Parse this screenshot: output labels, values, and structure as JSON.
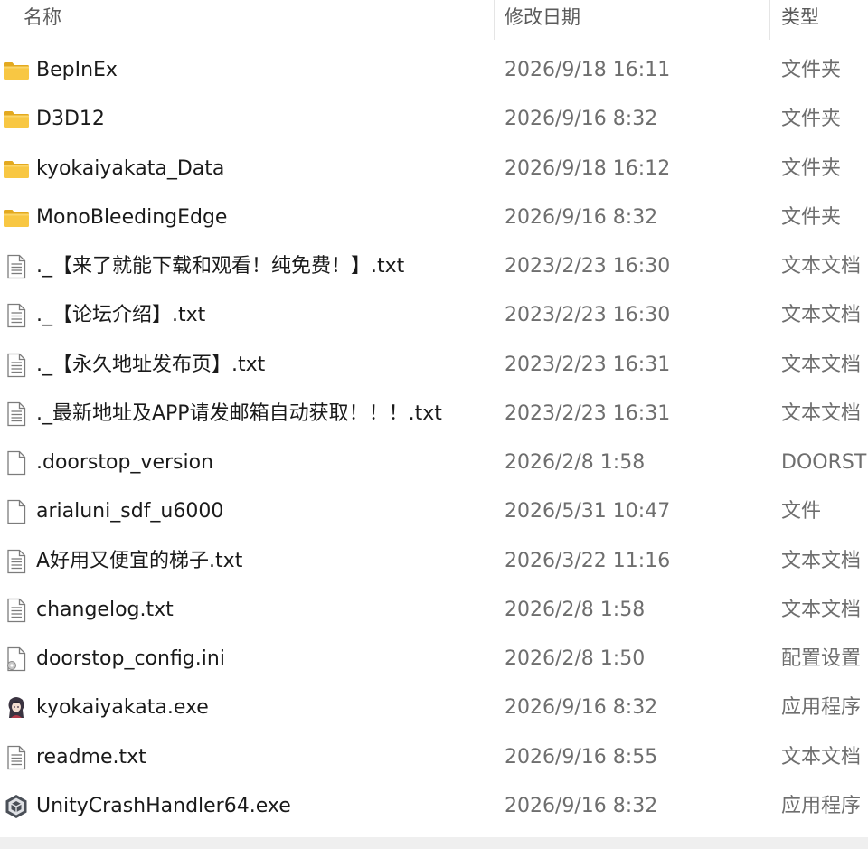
{
  "header": {
    "name_label": "名称",
    "date_label": "修改日期",
    "type_label": "类型"
  },
  "files": [
    {
      "name": "BepInEx",
      "date": "2026/9/18 16:11",
      "type": "文件夹",
      "icon": "folder-icon"
    },
    {
      "name": "D3D12",
      "date": "2026/9/16 8:32",
      "type": "文件夹",
      "icon": "folder-icon"
    },
    {
      "name": "kyokaiyakata_Data",
      "date": "2026/9/18 16:12",
      "type": "文件夹",
      "icon": "folder-icon"
    },
    {
      "name": "MonoBleedingEdge",
      "date": "2026/9/16 8:32",
      "type": "文件夹",
      "icon": "folder-icon"
    },
    {
      "name": "._【来了就能下载和观看！纯免费！】.txt",
      "date": "2023/2/23 16:30",
      "type": "文本文档",
      "icon": "text-file-icon"
    },
    {
      "name": "._【论坛介绍】.txt",
      "date": "2023/2/23 16:30",
      "type": "文本文档",
      "icon": "text-file-icon"
    },
    {
      "name": "._【永久地址发布页】.txt",
      "date": "2023/2/23 16:31",
      "type": "文本文档",
      "icon": "text-file-icon"
    },
    {
      "name": "._最新地址及APP请发邮箱自动获取！！！.txt",
      "date": "2023/2/23 16:31",
      "type": "文本文档",
      "icon": "text-file-icon"
    },
    {
      "name": ".doorstop_version",
      "date": "2026/2/8 1:58",
      "type": "DOORST",
      "icon": "blank-file-icon"
    },
    {
      "name": "arialuni_sdf_u6000",
      "date": "2026/5/31 10:47",
      "type": "文件",
      "icon": "blank-file-icon"
    },
    {
      "name": "A好用又便宜的梯子.txt",
      "date": "2026/3/22 11:16",
      "type": "文本文档",
      "icon": "text-file-icon"
    },
    {
      "name": "changelog.txt",
      "date": "2026/2/8 1:58",
      "type": "文本文档",
      "icon": "text-file-icon"
    },
    {
      "name": "doorstop_config.ini",
      "date": "2026/2/8 1:50",
      "type": "配置设置",
      "icon": "config-file-icon"
    },
    {
      "name": "kyokaiyakata.exe",
      "date": "2026/9/16 8:32",
      "type": "应用程序",
      "icon": "app-character-icon"
    },
    {
      "name": "readme.txt",
      "date": "2026/9/16 8:55",
      "type": "文本文档",
      "icon": "text-file-icon"
    },
    {
      "name": "UnityCrashHandler64.exe",
      "date": "2026/9/16 8:32",
      "type": "应用程序",
      "icon": "unity-icon"
    }
  ],
  "colors": {
    "folder": "#f8c743",
    "header_text": "#5b5b5b",
    "secondary_text": "#6e6e6e"
  }
}
